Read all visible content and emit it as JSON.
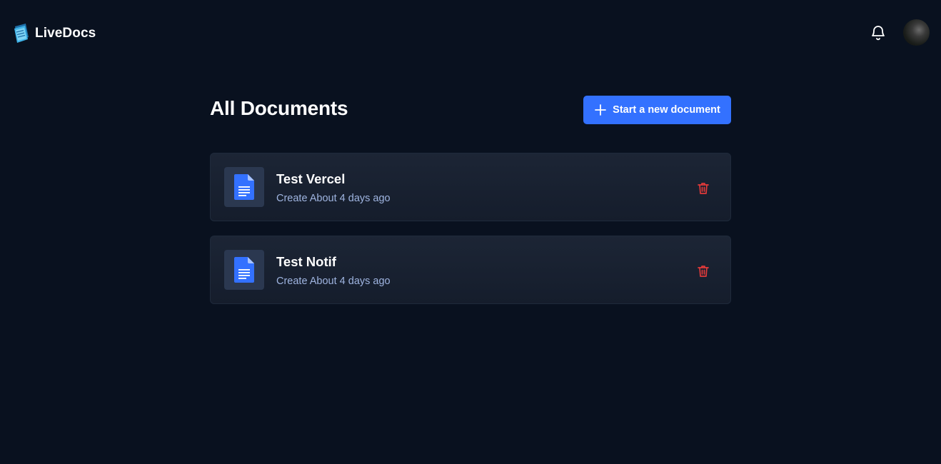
{
  "header": {
    "app_name": "LiveDocs",
    "logo_icon": "livedocs-logo-icon",
    "notification_icon": "bell-icon",
    "avatar_icon": "user-avatar"
  },
  "main": {
    "title": "All Documents",
    "new_document_label": "Start a new document",
    "new_document_icon": "plus-icon"
  },
  "documents": [
    {
      "title": "Test Vercel",
      "meta": "Create About 4 days ago",
      "icon": "document-icon",
      "delete_icon": "trash-icon"
    },
    {
      "title": "Test Notif",
      "meta": "Create About 4 days ago",
      "icon": "document-icon",
      "delete_icon": "trash-icon"
    }
  ],
  "colors": {
    "background": "#09111f",
    "accent": "#3371ff",
    "card": "#1a2232",
    "thumb": "#2b3850",
    "meta_text": "#9fb4e0",
    "danger": "#e03a3a"
  }
}
